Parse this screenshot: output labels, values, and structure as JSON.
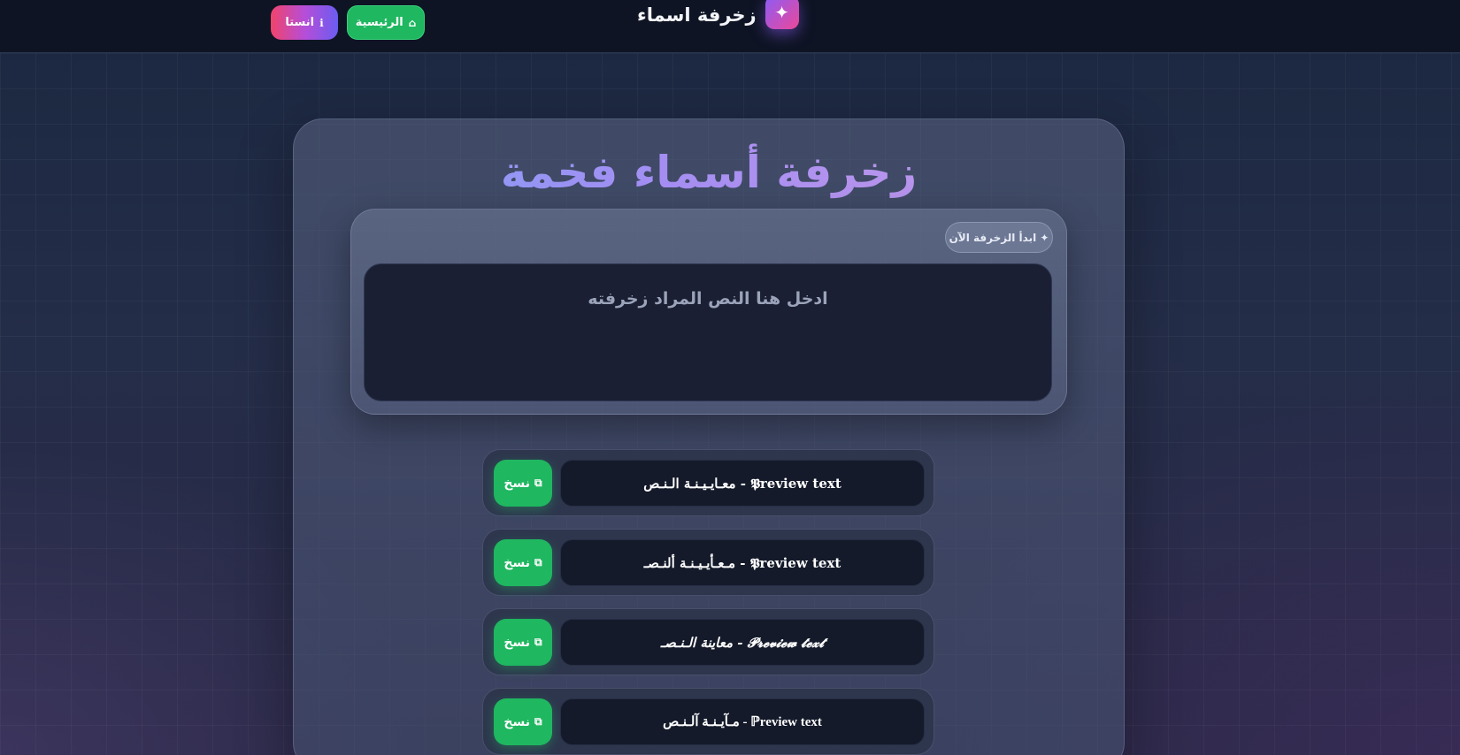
{
  "header": {
    "title": "زخرفة اسماء",
    "logo_glyph": "✦",
    "logo_icon": "sparkle-icon",
    "nav": {
      "home_label": "الرئيسية",
      "home_icon": "⌂",
      "insta_label": "انستا",
      "insta_icon": "ℹ"
    }
  },
  "main": {
    "title": "زخرفة أسماء فخمة",
    "start_badge": "✦ ابدأ الزخرفة الآن",
    "input_placeholder": "ادخل هنا النص المراد زخرفته",
    "input_value": ""
  },
  "results": {
    "copy_label": "نسخ",
    "copy_icon": "⧉",
    "items": [
      {
        "preview": "معـايـيـنـة الـنـص - 𝕻review text"
      },
      {
        "preview": "مـعـأيـيـنـة ألنـصـ - 𝕻review text"
      },
      {
        "preview": "معاينة الـنـصـ - 𝓟𝓻𝓮𝓿𝓲𝓮𝔀 𝓽𝓮𝔁𝓽"
      },
      {
        "preview": "مـآيـنـة آلـنـص - ℙreview text"
      }
    ]
  },
  "colors": {
    "accent_green": "#1fb760",
    "accent_purple": "#8b5cf6",
    "header_bg": "#0e1424"
  }
}
